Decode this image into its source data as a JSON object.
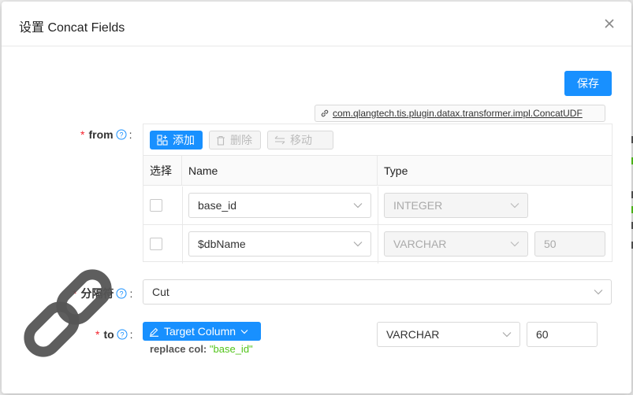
{
  "modal": {
    "title": "设置 Concat Fields",
    "save_label": "保存",
    "class_name": "com.qlangtech.tis.plugin.datax.transformer.impl.ConcatUDF"
  },
  "from": {
    "label": "from",
    "toolbar": {
      "add": "添加",
      "delete": "删除",
      "move": "移动"
    },
    "columns": [
      "选择",
      "Name",
      "Type"
    ],
    "rows": [
      {
        "name": "base_id",
        "type": "INTEGER",
        "length": ""
      },
      {
        "name": "$dbName",
        "type": "VARCHAR",
        "length": "50"
      }
    ]
  },
  "separator": {
    "label": "分隔符",
    "value": "Cut"
  },
  "to": {
    "label": "to",
    "button_label": "Target Column",
    "replace_key": "replace col:",
    "replace_value": "\"base_id\"",
    "type": "VARCHAR",
    "length": "60"
  },
  "colors": {
    "primary": "#1890ff",
    "required": "#f5222d",
    "value_green": "#52c41a"
  }
}
